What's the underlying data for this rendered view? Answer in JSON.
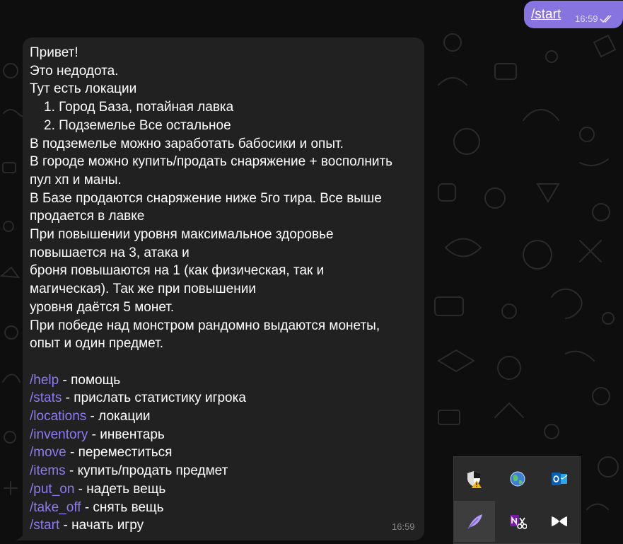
{
  "outgoing": {
    "text": "/start",
    "time": "16:59",
    "status_icon": "double-check-icon"
  },
  "incoming": {
    "time": "16:59",
    "lines": [
      "Привет!",
      "Это недодота.",
      "Тут есть локации",
      "1. Город База, потайная лавка",
      "2. Подземелье Все остальное",
      "В подземелье можно заработать бабосики и опыт.",
      "В городе можно купить/продать снаряжение + восполнить",
      "пул хп и маны.",
      "В Базе продаются снаряжение ниже 5го тира. Все выше",
      "продается в лавке",
      "При повышении уровня максимальное здоровье",
      "повышается на 3, атака и",
      "броня повышаются на 1 (как физическая, так и",
      "магическая). Так же при повышении",
      "уровня даётся 5 монет.",
      "При победе над монстром рандомно выдаются монеты,",
      "опыт и один предмет."
    ],
    "commands": [
      {
        "cmd": "/help",
        "desc": " - помощь"
      },
      {
        "cmd": "/stats",
        "desc": " - прислать статистику игрока"
      },
      {
        "cmd": "/locations",
        "desc": " - локации"
      },
      {
        "cmd": "/inventory",
        "desc": " - инвентарь"
      },
      {
        "cmd": "/move",
        "desc": " - переместиться"
      },
      {
        "cmd": "/items",
        "desc": " - купить/продать предмет"
      },
      {
        "cmd": "/put_on",
        "desc": " - надеть вещь"
      },
      {
        "cmd": "/take_off",
        "desc": " - снять вещь"
      },
      {
        "cmd": "/start",
        "desc": " - начать игру"
      }
    ]
  },
  "tray": {
    "icons": [
      "security-warning-icon",
      "globe-app-icon",
      "outlook-icon",
      "feather-app-icon",
      "onenote-clipper-icon",
      "bow-tie-app-icon"
    ]
  },
  "colors": {
    "background": "#0e0e0e",
    "outgoing_bubble": "#8774e1",
    "incoming_bubble": "#212121",
    "command_link": "#8d7bf0"
  }
}
